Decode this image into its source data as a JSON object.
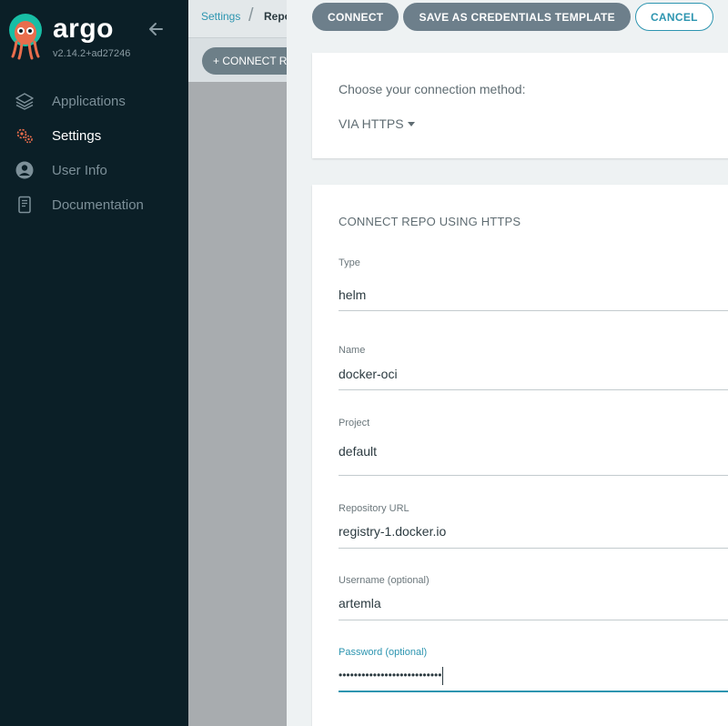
{
  "sidebar": {
    "brand": "argo",
    "version": "v2.14.2+ad27246",
    "items": [
      {
        "label": "Applications",
        "icon": "layers-icon"
      },
      {
        "label": "Settings",
        "icon": "gears-icon"
      },
      {
        "label": "User Info",
        "icon": "user-icon"
      },
      {
        "label": "Documentation",
        "icon": "book-icon"
      }
    ]
  },
  "breadcrumb": {
    "settings": "Settings",
    "current": "Repo"
  },
  "background": {
    "connect_button": "+ CONNECT R"
  },
  "panel": {
    "actions": {
      "connect": "CONNECT",
      "save_template": "SAVE AS CREDENTIALS TEMPLATE",
      "cancel": "CANCEL"
    },
    "method": {
      "label": "Choose your connection method:",
      "selected": "VIA HTTPS"
    },
    "form": {
      "title": "CONNECT REPO USING HTTPS",
      "type_label": "Type",
      "type_value": "helm",
      "name_label": "Name",
      "name_value": "docker-oci",
      "project_label": "Project",
      "project_value": "default",
      "url_label": "Repository URL",
      "url_value": "registry-1.docker.io",
      "username_label": "Username (optional)",
      "username_value": "artemla",
      "password_label": "Password (optional)",
      "password_value": "•••••••••••••••••••••••••••"
    }
  },
  "colors": {
    "sidebar_bg": "#0b1f27",
    "accent": "#2d95b0",
    "button": "#6d7f8b",
    "brand_orange": "#e96d4c"
  }
}
